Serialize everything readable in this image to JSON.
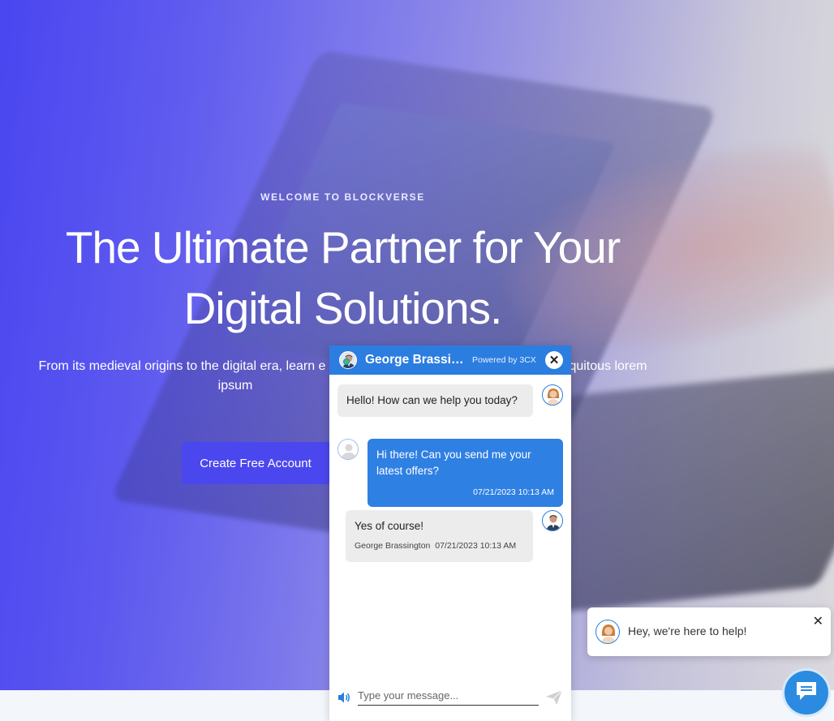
{
  "hero": {
    "eyebrow": "WELCOME TO BLOCKVERSE",
    "headline_line1": "The Ultimate Partner for Your",
    "headline_line2": "Digital Solutions.",
    "subtext_line1_left": "From its medieval origins to the digital era, learn e",
    "subtext_line1_right": "quitous lorem",
    "subtext_line2": "ipsum",
    "cta_label": "Create Free Account"
  },
  "chat": {
    "agent_name": "George Brassin...",
    "powered_by": "Powered by 3CX",
    "close_symbol": "✕",
    "messages": [
      {
        "direction": "in",
        "text": "Hello! How can we help you today?"
      },
      {
        "direction": "out",
        "text": "Hi there! Can you send me your latest offers?",
        "time": "07/21/2023 10:13 AM"
      },
      {
        "direction": "in",
        "text": "Yes of course!",
        "sender": "George Brassington",
        "time": "07/21/2023 10:13 AM"
      }
    ],
    "input_placeholder": "Type your message...",
    "icons": {
      "speaker": "speaker-icon",
      "send": "send-icon"
    }
  },
  "greeting": {
    "text": "Hey, we're here to help!",
    "close_symbol": "✕"
  },
  "launcher": {
    "icon": "chat-bubble-icon"
  },
  "colors": {
    "brand": "#4b47ef",
    "chat_blue": "#2b7de0",
    "online": "#39c45a"
  }
}
